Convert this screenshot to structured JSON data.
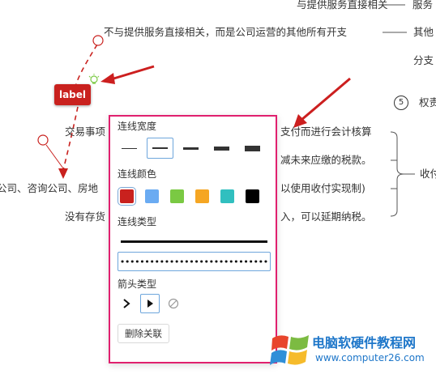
{
  "mindmap": {
    "nodes": [
      "与提供服务直接相关",
      "服务",
      "不与提供服务直接相关，而是公司运营的其他所有开支",
      "其他",
      "分支",
      "权责",
      "交易事项",
      "支付而进行会计核算",
      "减未来应缴的税款。",
      "收付",
      "公司、咨询公司、房地",
      "以使用收付实现制)",
      "没有存货",
      "入，可以延期纳税。"
    ],
    "circle_number": "5",
    "label_badge": "label"
  },
  "panel": {
    "line_width_title": "连线宽度",
    "line_color_title": "连线颜色",
    "line_type_title": "连线类型",
    "arrow_type_title": "箭头类型",
    "delete_button": "删除关联",
    "colors": [
      "#c9211e",
      "#6aabf2",
      "#7ac943",
      "#f5a623",
      "#31bfbf",
      "#000000"
    ],
    "selected_width_index": 1,
    "selected_color_index": 0,
    "selected_line_type": "dotted",
    "selected_arrow_type": "filled-triangle"
  },
  "watermark": {
    "title": "电脑软硬件教程网",
    "url": "www.computer26.com"
  },
  "colors": {
    "accent_highlight": "#e0206e",
    "annotation_red": "#cc1f1f",
    "selection_blue": "#6ea6dc"
  }
}
